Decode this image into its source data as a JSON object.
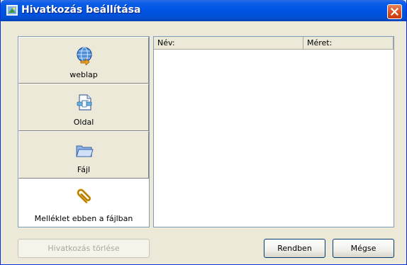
{
  "window": {
    "title": "Hivatkozás beállítása",
    "title_icon": "link-settings-icon",
    "accent": "#0054e3",
    "close_color": "#d94f1d"
  },
  "sidebar": {
    "items": [
      {
        "label": "weblap",
        "icon": "web-globe-icon",
        "active": false
      },
      {
        "label": "Oldal",
        "icon": "page-icon",
        "active": false
      },
      {
        "label": "Fájl",
        "icon": "folder-icon",
        "active": false
      },
      {
        "label": "Melléklet ebben a fájlban",
        "icon": "paperclip-icon",
        "active": true
      }
    ]
  },
  "list": {
    "columns": [
      {
        "label": "Név:"
      },
      {
        "label": "Méret:"
      }
    ],
    "rows": []
  },
  "buttons": {
    "remove_link": "Hivatkozás törlése",
    "ok": "Rendben",
    "cancel": "Mégse"
  }
}
